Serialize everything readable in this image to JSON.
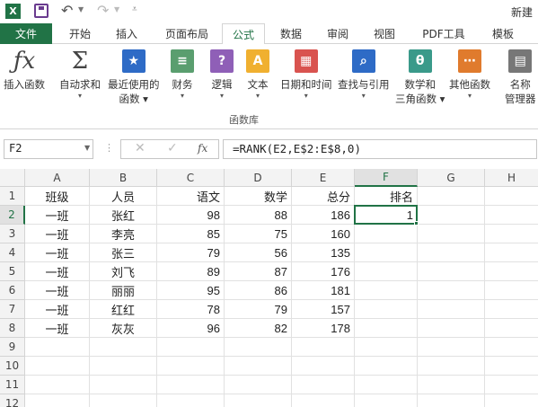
{
  "titlebar": {
    "app_logo": "X",
    "window_title": "新建"
  },
  "tabs": {
    "file": "文件",
    "items": [
      {
        "label": "开始",
        "key": "home"
      },
      {
        "label": "插入",
        "key": "insert"
      },
      {
        "label": "页面布局",
        "key": "layout"
      },
      {
        "label": "公式",
        "key": "formulas",
        "active": true
      },
      {
        "label": "数据",
        "key": "data"
      },
      {
        "label": "审阅",
        "key": "review"
      },
      {
        "label": "视图",
        "key": "view"
      },
      {
        "label": "PDF工具",
        "key": "pdf"
      },
      {
        "label": "模板",
        "key": "template"
      }
    ]
  },
  "ribbon": {
    "group_label": "函数库",
    "buttons": [
      {
        "key": "insert_function",
        "label1": "插入函数",
        "label2": "",
        "icon": "fx-icon",
        "color": "#444"
      },
      {
        "key": "autosum",
        "label1": "自动求和",
        "label2": "",
        "icon": "sigma-icon",
        "color": "#444"
      },
      {
        "key": "recent",
        "label1": "最近使用的",
        "label2": "函数",
        "icon": "star-book-icon",
        "color": "#2e6bc6"
      },
      {
        "key": "financial",
        "label1": "财务",
        "label2": "",
        "icon": "coins-book-icon",
        "color": "#5a9e6f"
      },
      {
        "key": "logical",
        "label1": "逻辑",
        "label2": "",
        "icon": "question-book-icon",
        "color": "#8f5fb7"
      },
      {
        "key": "text",
        "label1": "文本",
        "label2": "",
        "icon": "a-book-icon",
        "color": "#f0b030"
      },
      {
        "key": "datetime",
        "label1": "日期和时间",
        "label2": "",
        "icon": "calendar-book-icon",
        "color": "#d9534f"
      },
      {
        "key": "lookup",
        "label1": "查找与引用",
        "label2": "",
        "icon": "magnifier-book-icon",
        "color": "#2e6bc6"
      },
      {
        "key": "math",
        "label1": "数学和",
        "label2": "三角函数",
        "icon": "theta-book-icon",
        "color": "#3a9a8a"
      },
      {
        "key": "more",
        "label1": "其他函数",
        "label2": "",
        "icon": "more-book-icon",
        "color": "#e07b2d"
      },
      {
        "key": "name_manager",
        "label1": "名称",
        "label2": "管理器",
        "icon": "name-tag-icon",
        "color": "#777"
      }
    ]
  },
  "formula_bar": {
    "name_box": "F2",
    "fx_label": "fx",
    "formula": "=RANK(E2,E$2:E$8,0)"
  },
  "sheet": {
    "columns": [
      "A",
      "B",
      "C",
      "D",
      "E",
      "F",
      "G",
      "H"
    ],
    "selected_column": "F",
    "selected_row": "2",
    "rows": [
      {
        "num": "1",
        "cells": [
          "班级",
          "人员",
          "语文",
          "数学",
          "总分",
          "排名",
          "",
          ""
        ]
      },
      {
        "num": "2",
        "cells": [
          "一班",
          "张红",
          "98",
          "88",
          "186",
          "1",
          "",
          ""
        ]
      },
      {
        "num": "3",
        "cells": [
          "一班",
          "李亮",
          "85",
          "75",
          "160",
          "",
          "",
          ""
        ]
      },
      {
        "num": "4",
        "cells": [
          "一班",
          "张三",
          "79",
          "56",
          "135",
          "",
          "",
          ""
        ]
      },
      {
        "num": "5",
        "cells": [
          "一班",
          "刘飞",
          "89",
          "87",
          "176",
          "",
          "",
          ""
        ]
      },
      {
        "num": "6",
        "cells": [
          "一班",
          "丽丽",
          "95",
          "86",
          "181",
          "",
          "",
          ""
        ]
      },
      {
        "num": "7",
        "cells": [
          "一班",
          "红红",
          "78",
          "79",
          "157",
          "",
          "",
          ""
        ]
      },
      {
        "num": "8",
        "cells": [
          "一班",
          "灰灰",
          "96",
          "82",
          "178",
          "",
          "",
          ""
        ]
      },
      {
        "num": "9",
        "cells": [
          "",
          "",
          "",
          "",
          "",
          "",
          "",
          ""
        ]
      },
      {
        "num": "10",
        "cells": [
          "",
          "",
          "",
          "",
          "",
          "",
          "",
          ""
        ]
      },
      {
        "num": "11",
        "cells": [
          "",
          "",
          "",
          "",
          "",
          "",
          "",
          ""
        ]
      },
      {
        "num": "12",
        "cells": [
          "",
          "",
          "",
          "",
          "",
          "",
          "",
          ""
        ]
      }
    ]
  },
  "colors": {
    "accent": "#217346"
  }
}
